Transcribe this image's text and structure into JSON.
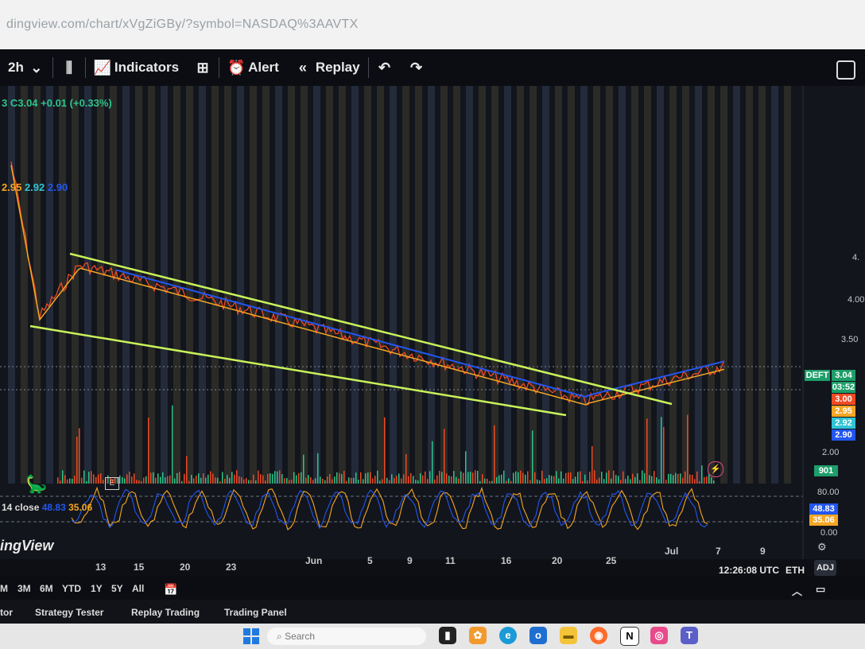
{
  "browser": {
    "url": "dingview.com/chart/xVgZiGBy/?symbol=NASDAQ%3AAVTX"
  },
  "toolbar": {
    "interval": "2h",
    "indicators_label": "Indicators",
    "alert_label": "Alert",
    "replay_label": "Replay"
  },
  "legend": {
    "ohlc": "3 C3.04 +0.01 (+0.33%)",
    "ma_values": [
      "2.95",
      "2.92",
      "2.90"
    ],
    "oscillator_label": "14 close",
    "oscillator_values": [
      "48.83",
      "35.06"
    ]
  },
  "price_axis": {
    "labels": [
      "4.",
      "4.00",
      "3.50",
      "2.00"
    ],
    "osc_labels": [
      "80.00",
      "0.00"
    ],
    "boxes": [
      {
        "text": "3.04",
        "color": "#1e9e6a"
      },
      {
        "text": "03:52",
        "color": "#1e9e6a"
      },
      {
        "text": "3.00",
        "color": "#f04a23"
      },
      {
        "text": "2.95",
        "color": "#f5a623"
      },
      {
        "text": "2.92",
        "color": "#2ec4d6"
      },
      {
        "text": "2.90",
        "color": "#2356f0"
      }
    ],
    "symbol_tag": "DEFT",
    "volume_box": "901",
    "osc_boxes": [
      {
        "text": "48.83",
        "color": "#2356f0"
      },
      {
        "text": "35.06",
        "color": "#f5a623"
      }
    ]
  },
  "time_axis": {
    "labels": [
      "13",
      "15",
      "20",
      "23",
      "Jun",
      "5",
      "9",
      "11",
      "16",
      "20",
      "25",
      "Jul",
      "7",
      "9"
    ],
    "clock": "12:26:08 UTC",
    "session": "ETH",
    "adj": "ADJ"
  },
  "brand": "ingView",
  "ranges": [
    "M",
    "3M",
    "6M",
    "YTD",
    "1Y",
    "5Y",
    "All"
  ],
  "panels": [
    "tor",
    "Strategy Tester",
    "Replay Trading",
    "Trading Panel"
  ],
  "taskbar": {
    "search_placeholder": "Search"
  },
  "colors": {
    "trendline": "#c9f25a",
    "ma_fast": "#f5a623",
    "ma_slow": "#2356f0",
    "price": "#f04a23"
  }
}
